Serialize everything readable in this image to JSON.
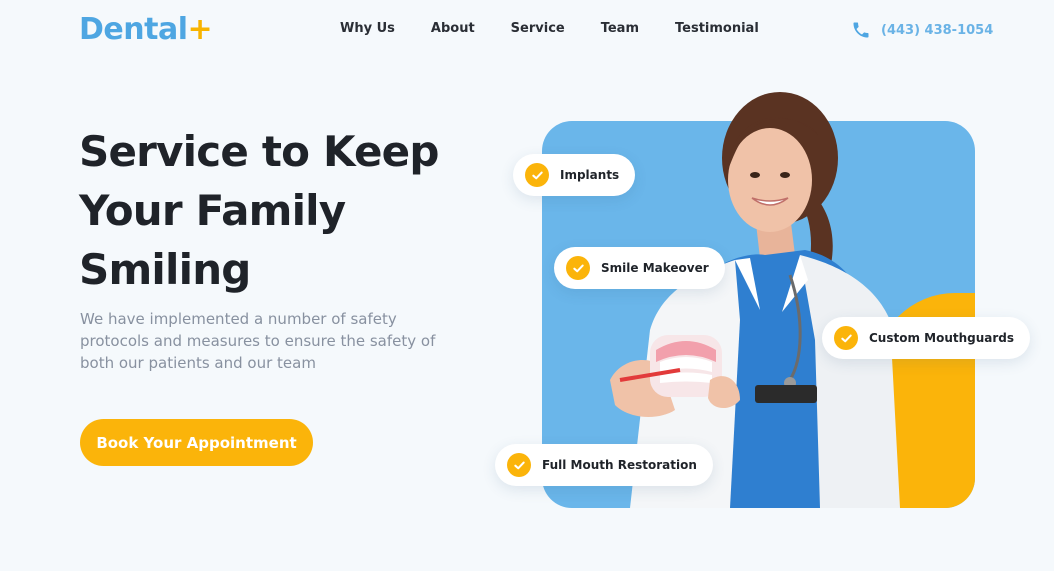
{
  "brand": {
    "name": "Dental",
    "plus": "+"
  },
  "nav": {
    "items": [
      {
        "label": "Why Us"
      },
      {
        "label": "About"
      },
      {
        "label": "Service"
      },
      {
        "label": "Team"
      },
      {
        "label": "Testimonial"
      }
    ]
  },
  "contact": {
    "phone": "(443) 438-1054"
  },
  "hero": {
    "headline_lines": [
      "Service to Keep",
      "Your Family",
      "Smiling"
    ],
    "description_lines": [
      "We have implemented a number of safety",
      "protocols and measures to ensure the safety of",
      "both our patients and our team"
    ],
    "cta_label": "Book Your Appointment"
  },
  "services": [
    {
      "label": "Implants"
    },
    {
      "label": "Smile Makeover"
    },
    {
      "label": "Custom Mouthguards"
    },
    {
      "label": "Full Mouth Restoration"
    }
  ],
  "colors": {
    "brand_blue": "#4ea6e2",
    "accent_yellow": "#fbb40a",
    "card_blue": "#6ab6ea"
  }
}
